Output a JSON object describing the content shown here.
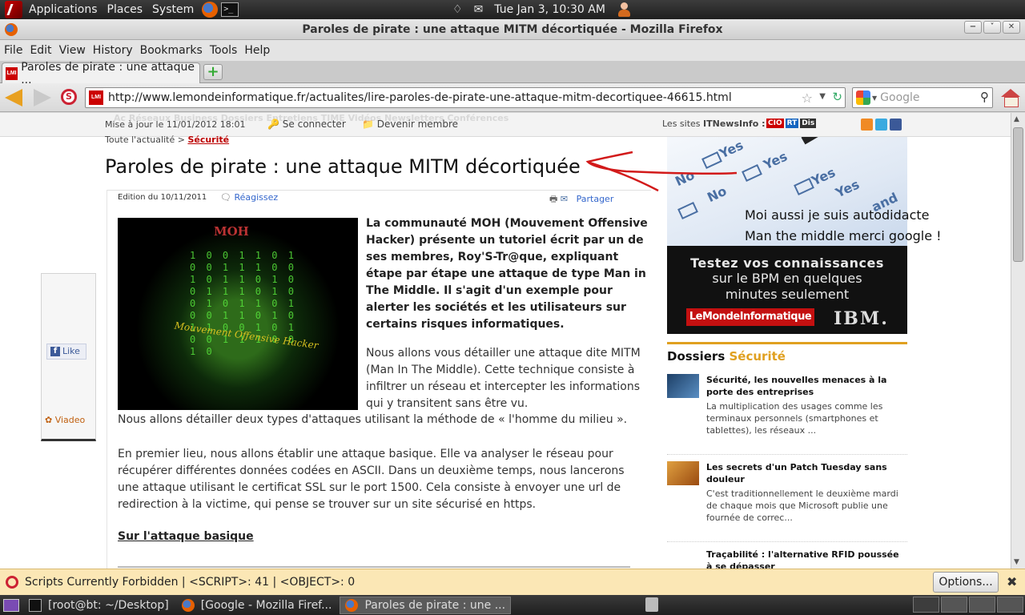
{
  "top_panel": {
    "applications": "Applications",
    "places": "Places",
    "system": "System",
    "clock": "Tue Jan  3, 10:30 AM"
  },
  "window": {
    "title": "Paroles de pirate : une attaque MITM décortiquée - Mozilla Firefox"
  },
  "menu": [
    "File",
    "Edit",
    "View",
    "History",
    "Bookmarks",
    "Tools",
    "Help"
  ],
  "tab": {
    "label": "Paroles de pirate : une attaque ...",
    "favicon_text": "LMI"
  },
  "nav": {
    "url": "http://www.lemondeinformatique.fr/actualites/lire-paroles-de-pirate-une-attaque-mitm-decortiquee-46615.html",
    "search_placeholder": "Google"
  },
  "site": {
    "updated": "Mise à jour le 11/01/2012 18:01",
    "login": "Se connecter",
    "member": "Devenir membre",
    "sites_label": "Les sites",
    "sites_brand": "ITNewsInfo :",
    "badges": [
      "CIO",
      "RT",
      "Dis"
    ],
    "ghost_nav": "Ac    Réseaux     Business      Dossiers       Entretiens       TIME       Vidéos       Newsletters       Conférences"
  },
  "article": {
    "breadcrumb_first": "Toute l'actualité",
    "breadcrumb_sep": ">",
    "breadcrumb_current": "Sécurité",
    "title": "Paroles de pirate : une attaque MITM décortiquée",
    "edition": "Edition du 10/11/2011",
    "react": "Réagissez",
    "share": "Partager",
    "hero_title": "MOH",
    "hero_caption": "Mouvement Offensive Hacker",
    "lead": "La communauté MOH (Mouvement Offensive Hacker) présente un tutoriel écrit par un de ses membres, Roy'S-Tr@que, expliquant étape par étape une attaque de type Man in The Middle. Il s'agit d'un exemple pour alerter les sociétés et les utilisateurs sur certains risques informatiques.",
    "para1": "Nous allons vous détailler une attaque dite MITM (Man In The Middle). Cette technique consiste à infiltrer un réseau et intercepter les informations qui y transitent sans être vu.",
    "para2": "Nous allons détailler deux types d'attaques utilisant la méthode de « l'homme du milieu ».",
    "para3": "En premier lieu, nous allons établir une attaque basique. Elle va analyser le réseau pour récupérer différentes données codées en ASCII. Dans un deuxième temps, nous lancerons une attaque utilisant le certificat SSL sur le port 1500. Cela consiste à envoyer une url de redirection à la victime, qui pense se trouver sur un site sécurisé en https.",
    "subhead": "Sur l'attaque basique"
  },
  "social_box": {
    "like": "Like",
    "viadeo": "Viadeo"
  },
  "quiz_words": [
    "Yes",
    "No",
    "Yes",
    "No",
    "Yes",
    "Yes",
    "and"
  ],
  "ad": {
    "line1": "Testez vos connaissances",
    "line2": "sur le BPM en quelques",
    "line3": "minutes seulement",
    "brand1": "LeMondeInformatique",
    "brand2": "IBM."
  },
  "dossiers": {
    "title": "Dossiers",
    "accent": "Sécurité",
    "items": [
      {
        "title": "Sécurité, les nouvelles menaces à la porte des entreprises",
        "desc": "La multiplication des usages comme les terminaux personnels (smartphones et tablettes), les réseaux ..."
      },
      {
        "title": "Les secrets d'un Patch Tuesday sans douleur",
        "desc": "C'est traditionnellement le deuxième mardi de chaque mois que Microsoft publie une fournée de correc..."
      },
      {
        "title": "Traçabilité : l'alternative RFID poussée à se dépasser",
        "desc": ""
      }
    ]
  },
  "annotation": {
    "line1": "Moi aussi je suis autodidacte",
    "line2": "Man the middle merci google !"
  },
  "noscript": {
    "message": "Scripts Currently Forbidden | <SCRIPT>: 41 | <OBJECT>: 0",
    "options": "Options..."
  },
  "taskbar": {
    "tasks": [
      "[root@bt: ~/Desktop]",
      "[Google - Mozilla Firef...",
      "Paroles de pirate : une ..."
    ]
  },
  "colors": {
    "accent_orange": "#e0a020",
    "lmi_red": "#c41010",
    "link_blue": "#3366cc",
    "noscript_bar": "#fbe7b5"
  }
}
